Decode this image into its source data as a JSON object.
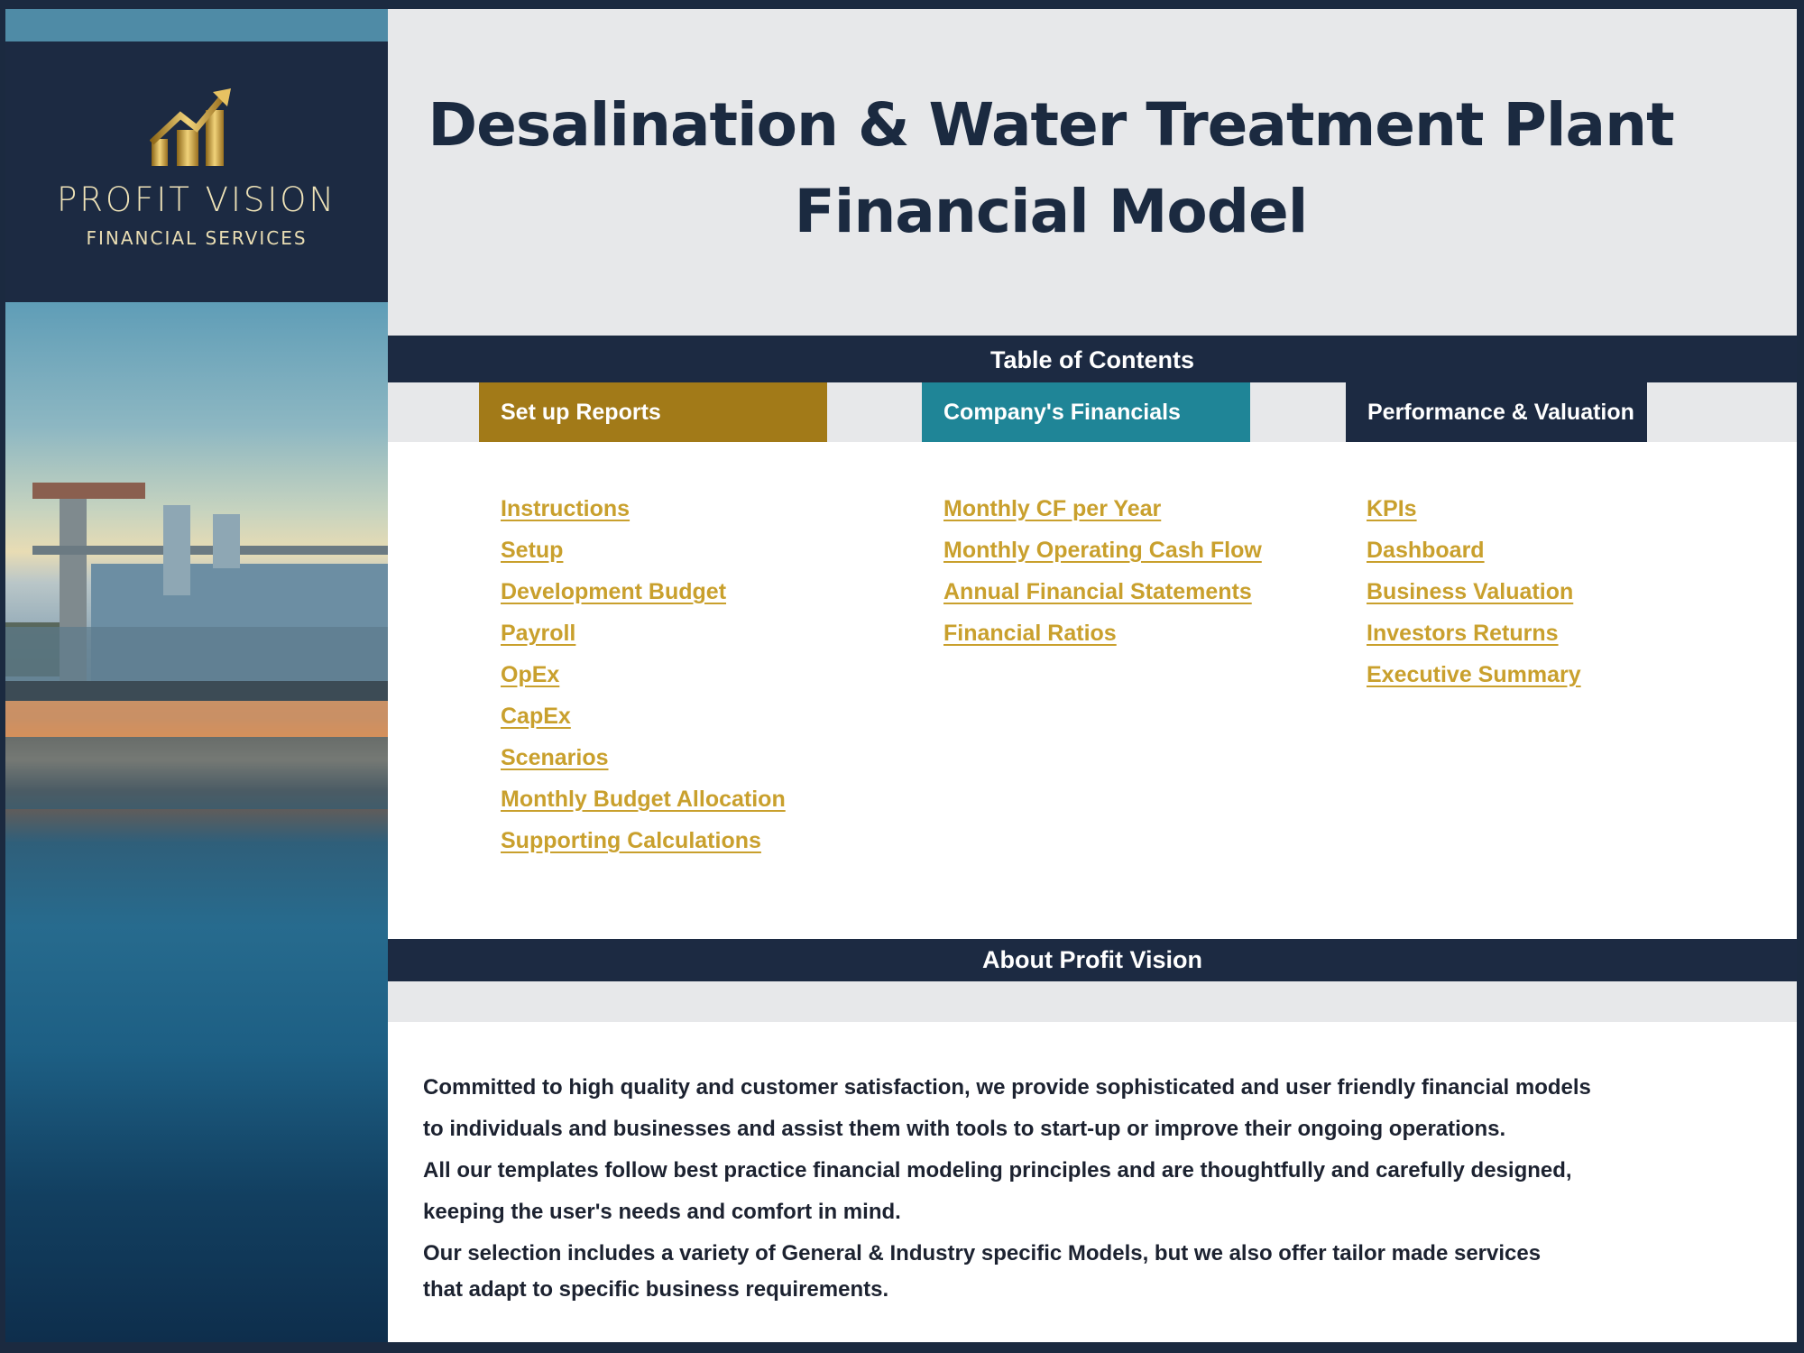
{
  "brand": {
    "name": "PROFIT VISION",
    "subtitle": "FINANCIAL SERVICES",
    "logo_icon": "rising-bar-chart-arrow-icon"
  },
  "header": {
    "title_line1": "Desalination & Water Treatment Plant",
    "title_line2": "Financial Model"
  },
  "toc": {
    "heading": "Table of Contents",
    "sections": [
      {
        "label": "Set up Reports",
        "color": "#a27a18",
        "links": [
          "Instructions",
          "Setup",
          "Development Budget",
          "Payroll",
          "OpEx",
          "CapEx",
          "Scenarios",
          "Monthly Budget Allocation",
          "Supporting Calculations"
        ]
      },
      {
        "label": "Company's Financials",
        "color": "#1f8597",
        "links": [
          "Monthly CF per Year",
          "Monthly Operating Cash Flow",
          "Annual Financial Statements",
          "Financial Ratios"
        ]
      },
      {
        "label": "Performance & Valuation",
        "color": "#1c2a42",
        "links": [
          "KPIs",
          "Dashboard",
          "Business Valuation",
          "Investors Returns",
          "Executive Summary"
        ]
      }
    ]
  },
  "about": {
    "heading": "About Profit Vision",
    "lines": [
      "Committed to high quality and customer satisfaction, we provide sophisticated and user friendly financial models",
      "to individuals and businesses and assist them  with tools to start-up or improve their ongoing operations.",
      "All our templates follow best practice financial modeling principles and are thoughtfully and carefully designed,",
      "keeping the user's needs and comfort in mind.",
      "Our selection includes a variety of General & Industry specific Models, but we also offer tailor made services",
      "that adapt to specific business requirements."
    ]
  },
  "colors": {
    "navy": "#1c2a42",
    "gold_link": "#c9a02d",
    "header_gray": "#e7e8ea"
  }
}
